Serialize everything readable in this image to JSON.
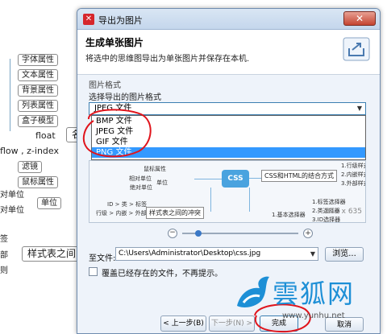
{
  "background": {
    "nodes": [
      "字体属性",
      "文本属性",
      "背景属性",
      "列表属性",
      "盒子模型",
      "float",
      "flow , z-index",
      "滤镜",
      "鼠标属性",
      "对单位",
      "单位",
      "对单位",
      "签",
      "部",
      "则",
      "样式表之间"
    ],
    "partial_labels": [
      "名"
    ]
  },
  "dialog": {
    "title": "导出为图片",
    "close_symbol": "✕",
    "header_title": "生成单张图片",
    "header_desc": "将选中的思维图导出为单张图片并保存在本机.",
    "group_label": "图片格式",
    "select_label": "选择导出的图片格式",
    "selected_format": "JPEG 文件",
    "format_options": [
      "BMP 文件",
      "JPEG 文件",
      "GIF 文件",
      "PNG 文件"
    ],
    "highlighted_option_index": 3,
    "preview": {
      "center": "CSS",
      "nodes": [
        "鼠标属性",
        "相对单位",
        "绝对单位",
        "单位",
        "ID > 类 > 标签",
        "行级 > 内嵌 > 外部",
        "样式表之间的冲突",
        "CSS和HTML的结合方式",
        "1.行级样式",
        "2.内嵌样式",
        "3.外部样式",
        "1.基本选择器",
        "1.标签选择器",
        "2.类选择器",
        "3.ID选择器"
      ],
      "size_text": "811 x 635"
    },
    "zoom_level": 0.12,
    "save_label": "至文件:",
    "save_path": "C:\\Users\\Administrator\\Desktop\\css.jpg",
    "browse_button": "浏览...",
    "overwrite_label": "覆盖已经存在的文件，不再提示。",
    "overwrite_checked": false,
    "buttons": {
      "prev": "< 上一步(B)",
      "next": "下一步(N) >",
      "finish": "完成",
      "cancel": "取消"
    }
  },
  "watermark": {
    "text": "雲狐网",
    "url": "www.yunhu.net"
  },
  "colors": {
    "accent": "#3399ff",
    "annotation": "#e0141c",
    "watermark": "#1d8fd6"
  }
}
